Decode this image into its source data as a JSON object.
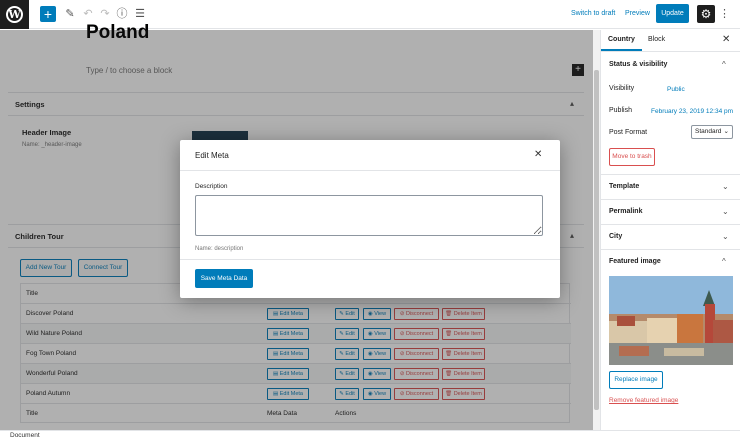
{
  "toolbar": {
    "switch_draft": "Switch to draft",
    "preview": "Preview",
    "update": "Update"
  },
  "editor": {
    "post_title": "Poland",
    "block_hint": "Type / to choose a block",
    "settings_title": "Settings",
    "header_image_label": "Header Image",
    "header_image_name": "Name: _header-image",
    "children_tour_title": "Children Tour",
    "add_new_tour": "Add New Tour",
    "connect_tour": "Connect Tour",
    "table": {
      "col_title": "Title",
      "col_meta": "Meta Data",
      "col_actions": "Actions",
      "rows": [
        {
          "title": "Discover Poland"
        },
        {
          "title": "Wild Nature Poland"
        },
        {
          "title": "Fog Town Poland"
        },
        {
          "title": "Wonderful Poland"
        },
        {
          "title": "Poland Autumn"
        }
      ],
      "edit_meta": "Edit Meta",
      "edit": "Edit",
      "view": "View",
      "disconnect": "Disconnect",
      "delete_item": "Delete Item"
    }
  },
  "footer": {
    "breadcrumb": "Document"
  },
  "sidebar": {
    "tab_country": "Country",
    "tab_block": "Block",
    "status_title": "Status & visibility",
    "visibility_label": "Visibility",
    "visibility_value": "Public",
    "publish_label": "Publish",
    "publish_value": "February 23, 2019 12:34 pm",
    "post_format_label": "Post Format",
    "post_format_value": "Standard",
    "move_trash": "Move to trash",
    "template": "Template",
    "permalink": "Permalink",
    "city": "City",
    "featured_image": "Featured image",
    "replace_image": "Replace image",
    "remove_image": "Remove featured image"
  },
  "modal": {
    "title": "Edit Meta",
    "description_label": "Description",
    "description_value": "",
    "description_help": "Name: description",
    "save_button": "Save Meta Data"
  },
  "colors": {
    "accent": "#007cba",
    "danger": "#d94f4f",
    "dark": "#1e1e1e"
  }
}
